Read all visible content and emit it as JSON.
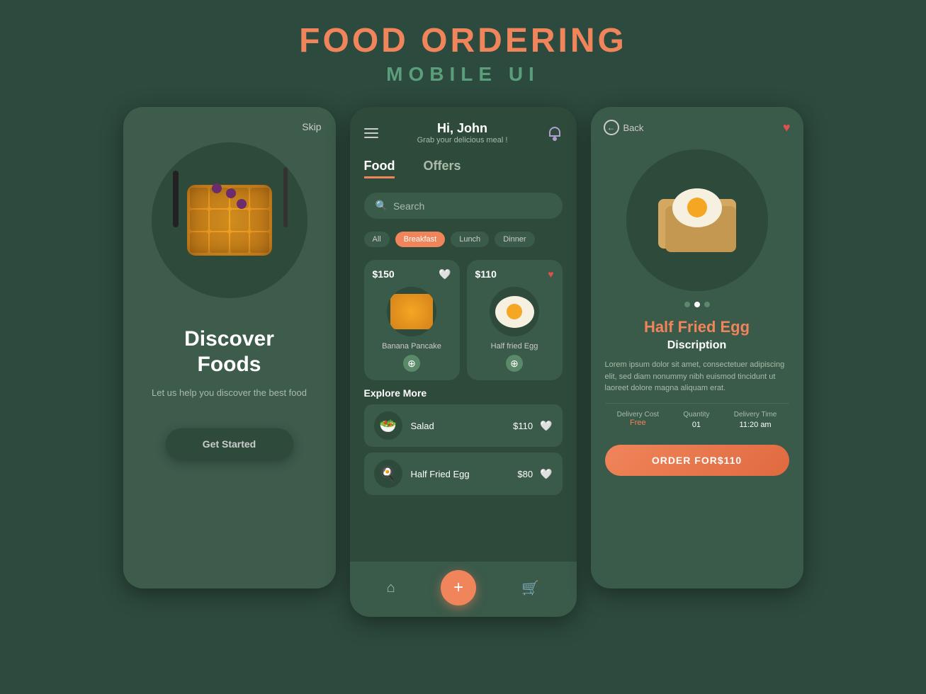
{
  "header": {
    "title": "FOOD ORDERING",
    "subtitle": "MOBILE UI"
  },
  "screen1": {
    "skip_label": "Skip",
    "title_line1": "Discover",
    "title_line2": "Foods",
    "subtitle": "Let us help you discover the best food",
    "cta_label": "Get Started"
  },
  "screen2": {
    "greeting_name": "Hi, John",
    "greeting_sub": "Grab your delicious meal !",
    "tab_food": "Food",
    "tab_offers": "Offers",
    "search_placeholder": "Search",
    "categories": [
      "All",
      "Breakfast",
      "Lunch",
      "Dinner"
    ],
    "featured": [
      {
        "price": "$150",
        "name": "Banana Pancake"
      },
      {
        "price": "$110",
        "name": "Half fried Egg"
      }
    ],
    "explore_label": "Explore More",
    "list_items": [
      {
        "name": "Salad",
        "price": "$110"
      },
      {
        "name": "Half Fried Egg",
        "price": "$80"
      }
    ],
    "nav_add": "+"
  },
  "screen3": {
    "back_label": "Back",
    "food_title": "Half Fried Egg",
    "food_subtitle": "Discription",
    "description": "Lorem ipsum dolor sit amet, consectetuer adipiscing elit, sed diam nonummy nibh euismod tincidunt ut laoreet dolore magna aliquam erat.",
    "delivery_cost_label": "Delivery Cost",
    "delivery_cost_value": "Free",
    "quantity_label": "Quantity",
    "quantity_value": "01",
    "delivery_time_label": "Delivery Time",
    "delivery_time_value": "11:20 am",
    "order_btn": "ORDER FOR$110"
  }
}
